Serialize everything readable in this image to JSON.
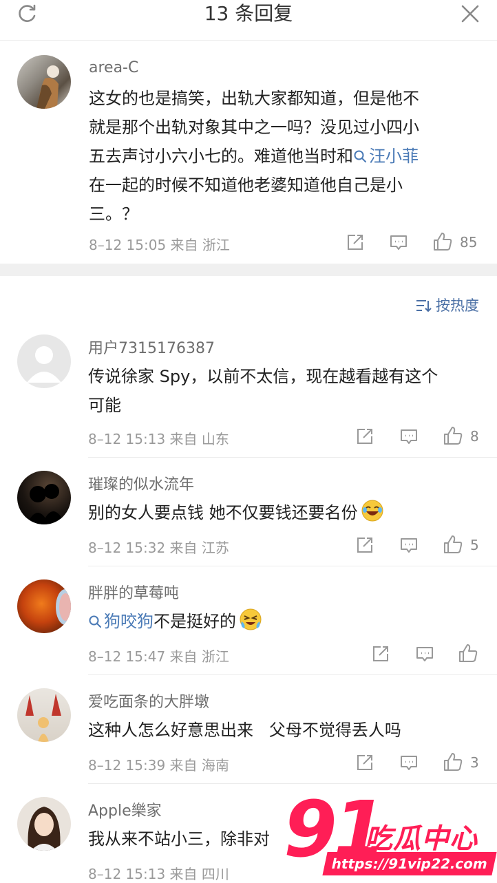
{
  "header": {
    "title": "13 条回复"
  },
  "post": {
    "username": "area-C",
    "lines": [
      "这女的也是搞笑，出轨大家都知道，但是他不",
      "就是那个出轨对象其中之一吗？没见过小四小",
      "五去声讨小六小七的。难道他当时和",
      "在一起的时候不知道他老婆知道他自己是小",
      "三。？"
    ],
    "topic": "汪小菲",
    "meta": "8–12 15:05  来自 浙江",
    "likes": "85"
  },
  "sort": {
    "label": "按热度"
  },
  "replies": [
    {
      "username": "用户7315176387",
      "lines": [
        "传说徐家 Spy，以前不太信，现在越看越有这个",
        "可能"
      ],
      "meta": "8–12 15:13  来自 山东",
      "likes": "8"
    },
    {
      "username": "璀璨的似水流年",
      "text": "别的女人要点钱 她不仅要钱还要名份",
      "meta": "8–12 15:32  来自 江苏",
      "likes": "5"
    },
    {
      "username": "胖胖的草莓吨",
      "topic": "狗咬狗",
      "text": "不是挺好的",
      "meta": "8–12 15:47  来自 浙江",
      "likes": ""
    },
    {
      "username": "爱吃面条的大胖墩",
      "text": "这种人怎么好意思出来   父母不觉得丢人吗",
      "meta": "8–12 15:39  来自 海南",
      "likes": "3"
    },
    {
      "username": "Apple樂家",
      "text": "我从来不站小三，除非对",
      "meta": "8–12 15:13  来自 四川",
      "likes": ""
    }
  ],
  "watermark": {
    "number": "91",
    "text": "吃瓜中心",
    "url": "https://91vip22.com"
  },
  "colors": {
    "link": "#4a7ab6",
    "watermark": "#ff1e56",
    "separator": "#f0f0f0"
  }
}
